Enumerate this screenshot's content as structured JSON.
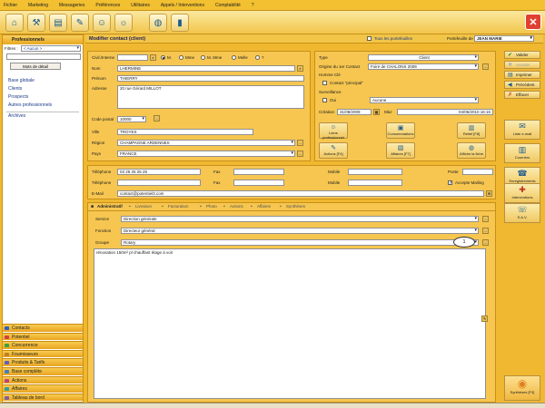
{
  "menu": [
    "Fichier",
    "Marketing",
    "Messageries",
    "Préférences",
    "Utilitaires",
    "Appels / Interventions",
    "Comptabilité",
    "?"
  ],
  "header": {
    "title": "Modifier contact (client)",
    "all_portfolios": "Tous les portefeuilles",
    "portfolio_label": "Portefeuille de",
    "portfolio_value": "JEAN MARIE"
  },
  "sidebar": {
    "title": "Professionnels",
    "filter_label": "Filtres :",
    "filter_value": "< Aucun >",
    "keyword_button": "Mots de détail",
    "items": [
      "Base globale",
      "Clients",
      "Prospects",
      "Autres professionnels",
      "Archives"
    ],
    "bottom_nav": [
      {
        "label": "Contacts",
        "color": "#3060c0"
      },
      {
        "label": "Potentiel",
        "color": "#d04040"
      },
      {
        "label": "Concurrence",
        "color": "#40a040"
      },
      {
        "label": "Fournisseurs",
        "color": "#c08020"
      },
      {
        "label": "Produits & Tarifs",
        "color": "#6060c0"
      },
      {
        "label": "Base complète",
        "color": "#4080c0"
      },
      {
        "label": "Actions",
        "color": "#c04080"
      },
      {
        "label": "Affaires",
        "color": "#30a0a0"
      },
      {
        "label": "Tableau de bord",
        "color": "#8060a0"
      }
    ]
  },
  "contact": {
    "civility_label": "Civil./Interne",
    "civility_options": [
      "M.",
      "Mme",
      "M. Mme",
      "Melle",
      "?"
    ],
    "civility_selected": 0,
    "nom_label": "Nom",
    "nom": "LHERMINE",
    "prenom_label": "Prénom",
    "prenom": "THIERRY",
    "adresse_label": "Adresse",
    "adresse": "20 rue Gérard MILLOT",
    "cp_label": "Code postal",
    "cp": "10000",
    "ville_label": "Ville",
    "ville": "TROYES",
    "region_label": "Région",
    "region": "CHAMPAGNE ARDENNES",
    "pays_label": "Pays",
    "pays": "FRANCE"
  },
  "type_panel": {
    "type_label": "Type",
    "type_value": "Client",
    "origine_label": "Origine du 1er Contact",
    "origine_value": "Foire de CHALONS 2009",
    "homme_cle_label": "Homme Clé",
    "contact_principal": "Contact \"principal\"",
    "surveillance_label": "Surveillance",
    "oui_label": "Oui",
    "surveillance_value": "Aucune",
    "creation_label": "Création",
    "creation_value": "31/08/2009",
    "maj_label": "MàJ",
    "maj_value": "04/06/2010 16:15",
    "buttons": [
      {
        "label": "Liens professionnel",
        "icon": "people-icon"
      },
      {
        "label": "Consommations",
        "icon": "cart-icon"
      },
      {
        "label": "Relief [F8]",
        "icon": "relief-icon"
      },
      {
        "label": "Actions [F4]",
        "icon": "actions-icon"
      },
      {
        "label": "Affaires [F7]",
        "icon": "affaires-icon"
      },
      {
        "label": "Affiche la fiche",
        "icon": "globe-icon"
      }
    ]
  },
  "phones": {
    "tel_label": "Téléphone",
    "tel1": "03 25 25 25 25",
    "tel2": "",
    "fax_label": "Fax",
    "mobile_label": "Mobile",
    "poste_label": "Poste",
    "accepte_mailing": "Accepte Mailing",
    "email_label": "E-Mail",
    "email": "contact@potentiel3.com"
  },
  "tabs": [
    "Administratif",
    "Livraison",
    "Facturation",
    "Photo",
    "Actions",
    "Affaires",
    "Synthèses"
  ],
  "admin": {
    "service_label": "Service",
    "service": "Direction générale",
    "fonction_label": "Fonction",
    "fonction": "Directeur général",
    "groupe_label": "Groupe",
    "groupe": "Rotary",
    "badge": "1",
    "notes": "rénovation 150m² pl chauffant étage à voir"
  },
  "right_buttons": [
    {
      "label": "Valider",
      "icon": "check-icon",
      "color": "#2a8a2a"
    },
    {
      "label": "Annuler",
      "icon": "cancel-icon",
      "color": "#b0b0b0"
    },
    {
      "label": "Imprimer",
      "icon": "printer-icon",
      "color": "#205a8a"
    },
    {
      "label": "Précédent",
      "icon": "back-icon",
      "color": "#205a8a"
    },
    {
      "label": "Effacer",
      "icon": "eraser-icon",
      "color": "#c04020"
    }
  ],
  "right_big": [
    {
      "label": "Liste e-mail",
      "icon": "mail-list-icon"
    },
    {
      "label": "Courriers",
      "icon": "letters-icon"
    },
    {
      "label": "Enregistrements",
      "icon": "records-icon"
    },
    {
      "label": "Interventions",
      "icon": "interventions-icon"
    },
    {
      "label": "S.A.V.",
      "icon": "sav-icon"
    },
    {
      "label": "Synthèses [F3]",
      "icon": "synthesis-icon"
    }
  ]
}
